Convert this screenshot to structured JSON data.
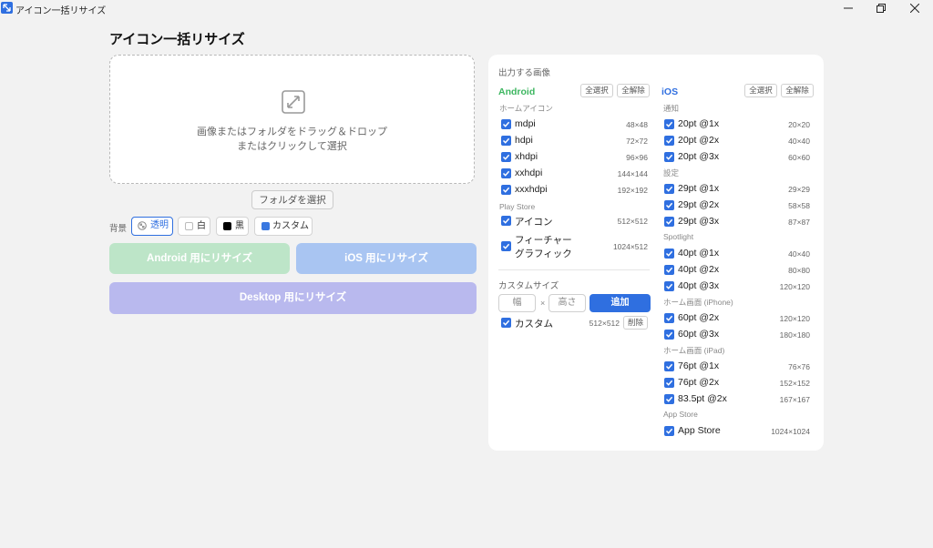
{
  "window": {
    "title": "アイコン一括リサイズ"
  },
  "page": {
    "title": "アイコン一括リサイズ"
  },
  "dropzone": {
    "line1": "画像またはフォルダをドラッグ＆ドロップ",
    "line2": "またはクリックして選択"
  },
  "folder_button": "フォルダを選択",
  "background": {
    "label": "背景",
    "options": [
      "透明",
      "白",
      "黒",
      "カスタム"
    ],
    "selected": "透明",
    "custom_color": "#3a78e0"
  },
  "actions": {
    "android": "Android 用にリサイズ",
    "ios": "iOS 用にリサイズ",
    "desktop": "Desktop 用にリサイズ"
  },
  "panel": {
    "title": "出力する画像",
    "select_all": "全選択",
    "deselect_all": "全解除",
    "android": {
      "title": "Android",
      "color": "#3db660",
      "home_group": "ホームアイコン",
      "home_items": [
        {
          "label": "mdpi",
          "size": "48×48"
        },
        {
          "label": "hdpi",
          "size": "72×72"
        },
        {
          "label": "xhdpi",
          "size": "96×96"
        },
        {
          "label": "xxhdpi",
          "size": "144×144"
        },
        {
          "label": "xxxhdpi",
          "size": "192×192"
        }
      ],
      "play_group": "Play Store",
      "play_items": [
        {
          "label": "アイコン",
          "size": "512×512"
        },
        {
          "label_line1": "フィーチャー",
          "label_line2": "グラフィック",
          "size": "1024×512"
        }
      ]
    },
    "custom": {
      "title": "カスタムサイズ",
      "width_placeholder": "幅",
      "times": "×",
      "height_placeholder": "高さ",
      "add": "追加",
      "item": {
        "label": "カスタム",
        "size": "512×512",
        "delete": "削除"
      }
    },
    "ios": {
      "title": "iOS",
      "color": "#2f6fe0",
      "groups": [
        {
          "name": "通知",
          "items": [
            {
              "label": "20pt @1x",
              "size": "20×20"
            },
            {
              "label": "20pt @2x",
              "size": "40×40"
            },
            {
              "label": "20pt @3x",
              "size": "60×60"
            }
          ]
        },
        {
          "name": "設定",
          "items": [
            {
              "label": "29pt @1x",
              "size": "29×29"
            },
            {
              "label": "29pt @2x",
              "size": "58×58"
            },
            {
              "label": "29pt @3x",
              "size": "87×87"
            }
          ]
        },
        {
          "name": "Spotlight",
          "items": [
            {
              "label": "40pt @1x",
              "size": "40×40"
            },
            {
              "label": "40pt @2x",
              "size": "80×80"
            },
            {
              "label": "40pt @3x",
              "size": "120×120"
            }
          ]
        },
        {
          "name": "ホーム画面 (iPhone)",
          "items": [
            {
              "label": "60pt @2x",
              "size": "120×120"
            },
            {
              "label": "60pt @3x",
              "size": "180×180"
            }
          ]
        },
        {
          "name": "ホーム画面 (iPad)",
          "items": [
            {
              "label": "76pt @1x",
              "size": "76×76"
            },
            {
              "label": "76pt @2x",
              "size": "152×152"
            },
            {
              "label": "83.5pt @2x",
              "size": "167×167"
            }
          ]
        },
        {
          "name": "App Store",
          "items": [
            {
              "label": "App Store",
              "size": "1024×1024"
            }
          ]
        }
      ]
    }
  }
}
